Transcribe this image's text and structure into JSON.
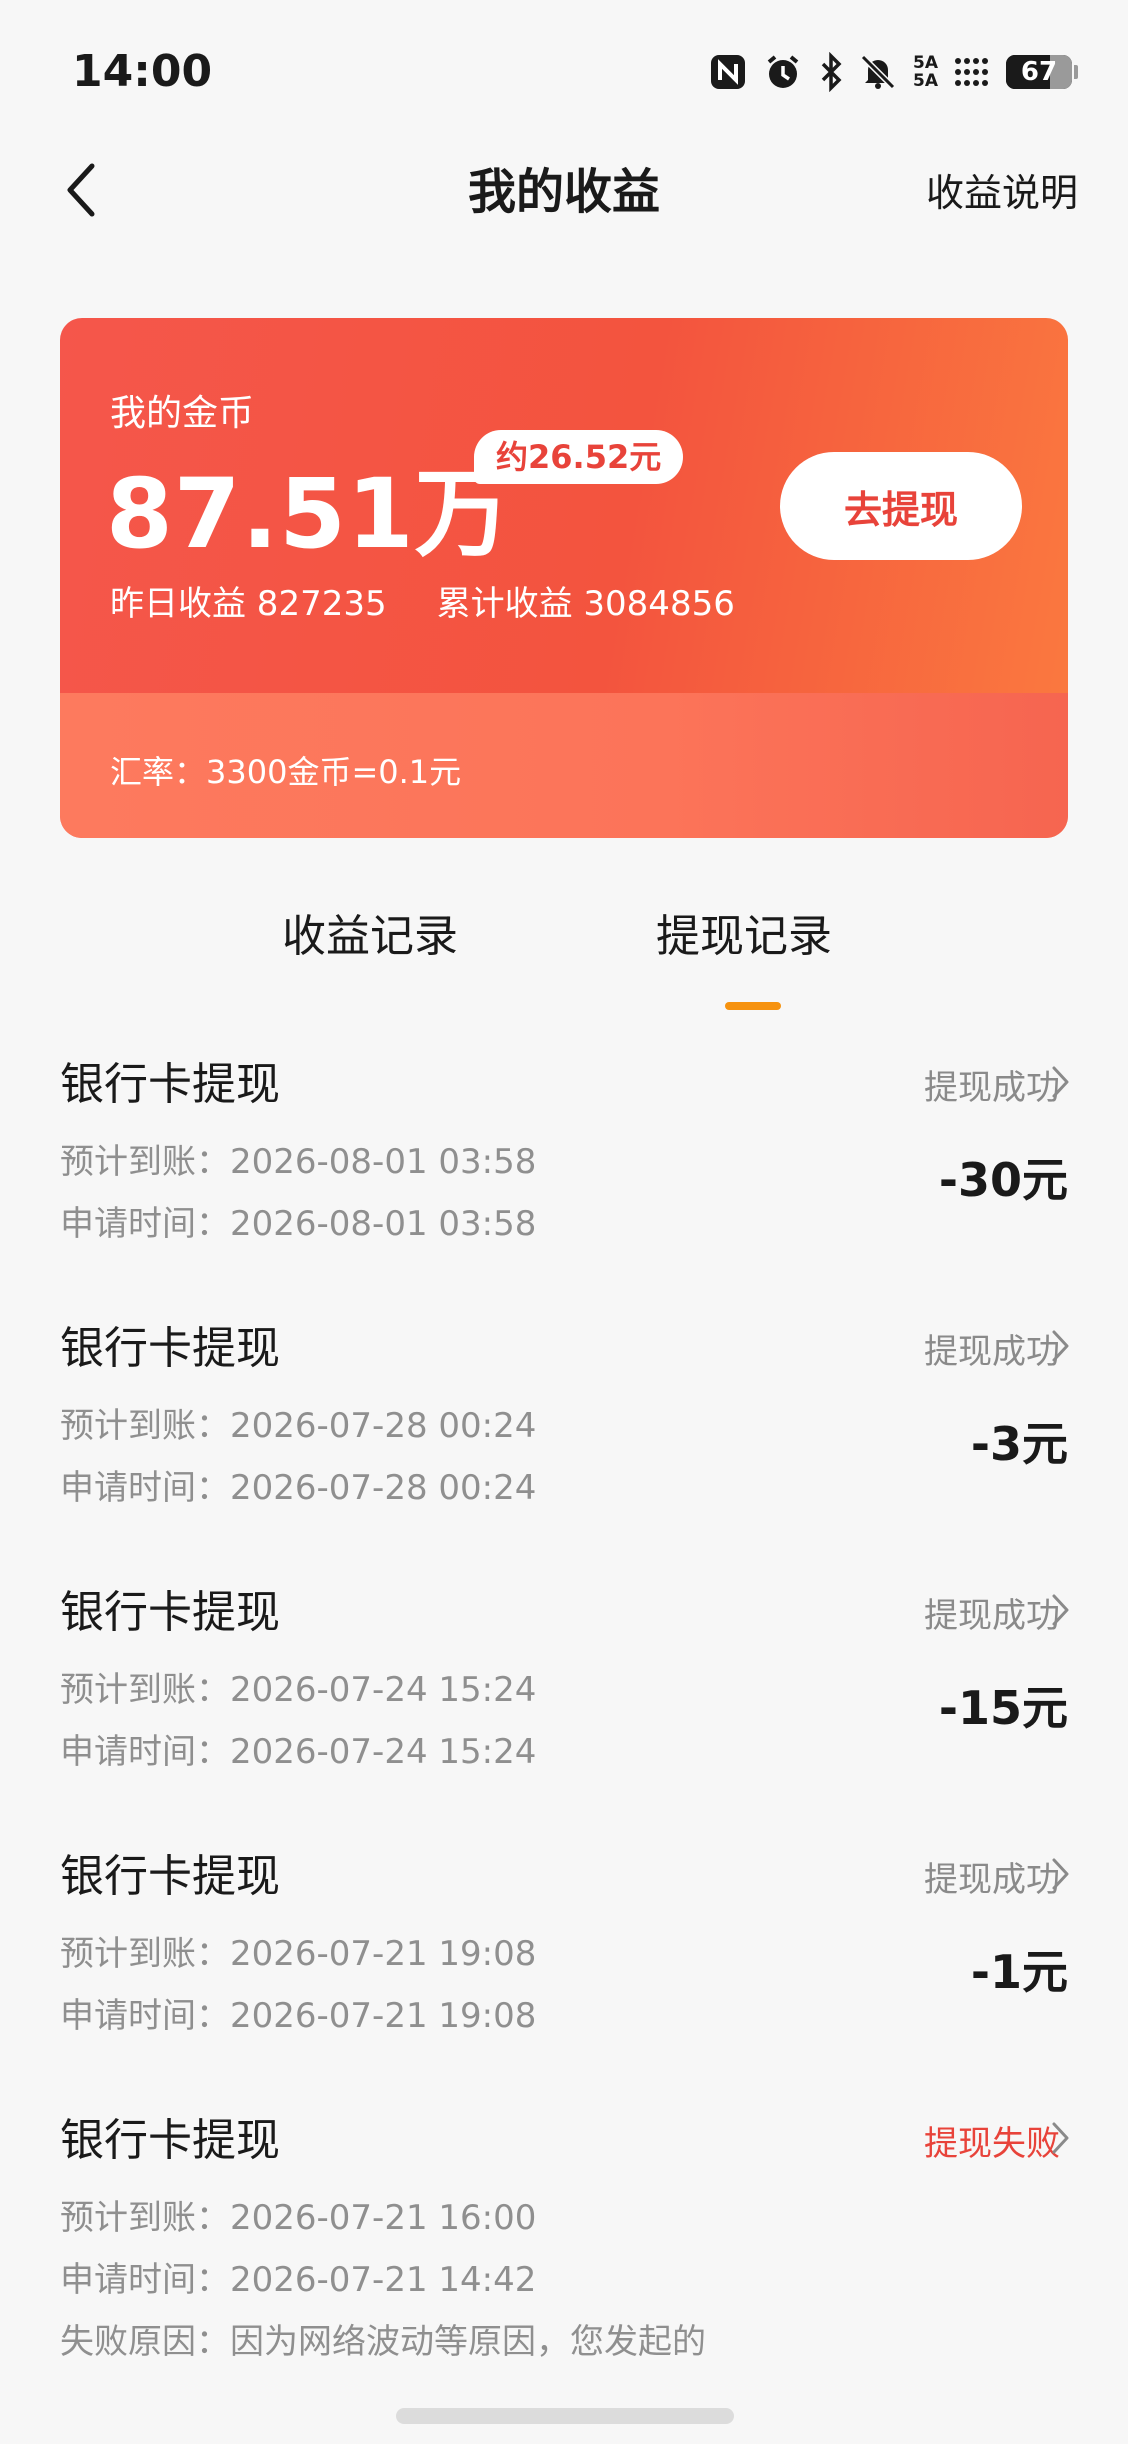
{
  "status_bar": {
    "time": "14:00",
    "network_label_top": "5A",
    "network_label_bottom": "5A",
    "battery_level": "67",
    "battery_fraction": 0.67,
    "icons": [
      "nfc-icon",
      "alarm-icon",
      "bluetooth-icon",
      "mute-bell-icon",
      "signal-icon",
      "battery-icon"
    ]
  },
  "nav": {
    "title": "我的收益",
    "action_label": "收益说明"
  },
  "card": {
    "coin_label": "我的金币",
    "coin_value": "87.51万",
    "approx_value": "约26.52元",
    "withdraw_label": "去提现",
    "yesterday_label": "昨日收益 827235",
    "total_label": "累计收益 3084856",
    "rate_label": "汇率：3300金币=0.1元",
    "colors": {
      "primary": "#f3543e",
      "accent_text": "#e8433a"
    }
  },
  "tabs": {
    "items": [
      {
        "label": "收益记录",
        "active": false
      },
      {
        "label": "提现记录",
        "active": true
      }
    ],
    "indicator_color": "#f6920f"
  },
  "records": [
    {
      "title": "银行卡提现",
      "status": "提现成功",
      "expected": "预计到账：2026-08-01 03:58",
      "applied": "申请时间：2026-08-01 03:58",
      "amount": "-30元",
      "failed": false
    },
    {
      "title": "银行卡提现",
      "status": "提现成功",
      "expected": "预计到账：2026-07-28 00:24",
      "applied": "申请时间：2026-07-28 00:24",
      "amount": "-3元",
      "failed": false
    },
    {
      "title": "银行卡提现",
      "status": "提现成功",
      "expected": "预计到账：2026-07-24 15:24",
      "applied": "申请时间：2026-07-24 15:24",
      "amount": "-15元",
      "failed": false
    },
    {
      "title": "银行卡提现",
      "status": "提现成功",
      "expected": "预计到账：2026-07-21 19:08",
      "applied": "申请时间：2026-07-21 19:08",
      "amount": "-1元",
      "failed": false
    },
    {
      "title": "银行卡提现",
      "status": "提现失败",
      "expected": "预计到账：2026-07-21 16:00",
      "applied": "申请时间：2026-07-21 14:42",
      "reason": "失败原因：因为网络波动等原因，您发起的",
      "amount": "",
      "failed": true
    }
  ],
  "colors": {
    "fail_status": "#e8433a",
    "success_status": "#8a8a8a"
  }
}
